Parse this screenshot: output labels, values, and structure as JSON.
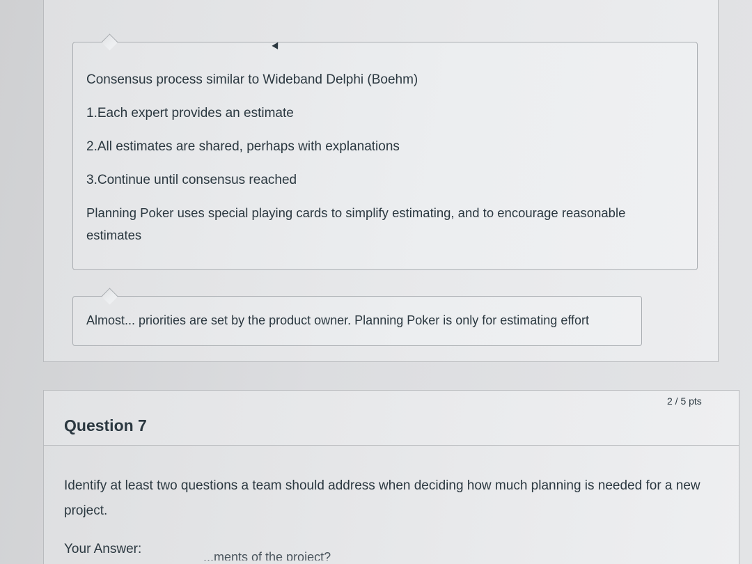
{
  "previous_question": {
    "neutral_comment": {
      "line1": "Consensus process similar to Wideband Delphi (Boehm)",
      "line2": "1.Each expert provides an estimate",
      "line3": "2.All estimates are shared, perhaps with explanations",
      "line4": "3.Continue until consensus reached",
      "paragraph": "Planning Poker uses special playing cards to simplify estimating, and to encourage reasonable estimates"
    },
    "incorrect_comment": {
      "text": "Almost... priorities are set by the product owner. Planning Poker is only for estimating effort"
    }
  },
  "question7": {
    "title": "Question 7",
    "points": "2 / 5 pts",
    "text": "Identify at least two questions a team should address when deciding how much planning is needed for a new project.",
    "answer_label": "Your Answer:",
    "answer_partial": "...ments of the project?"
  }
}
